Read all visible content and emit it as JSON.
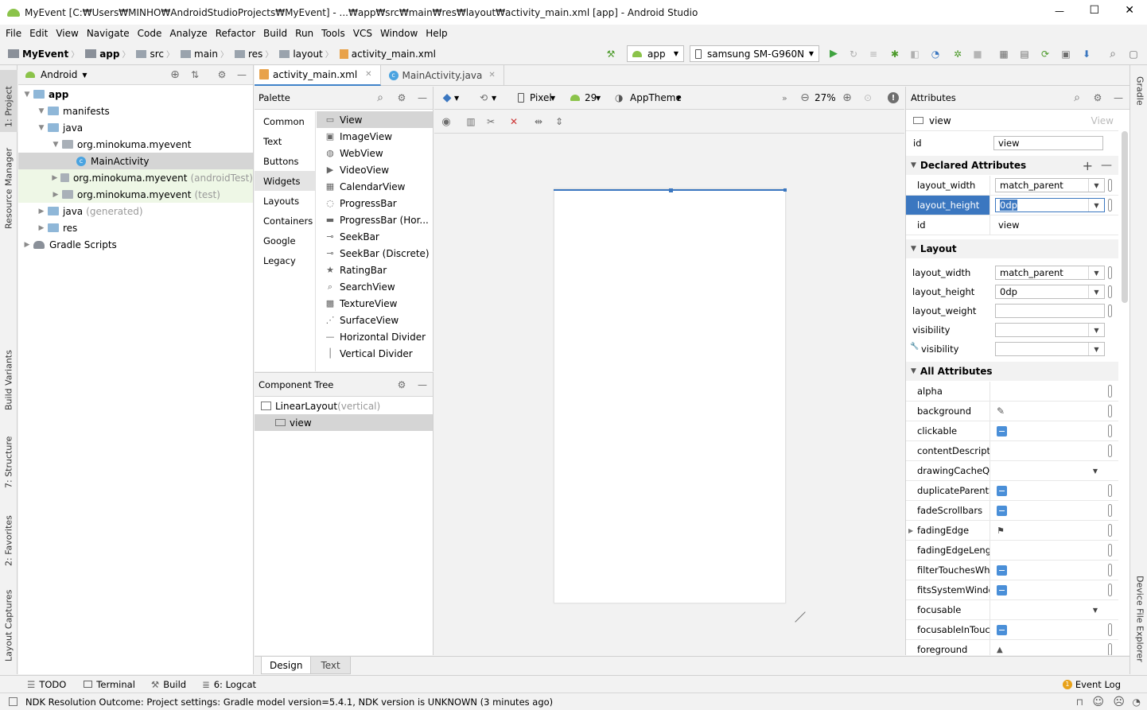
{
  "window": {
    "title": "MyEvent [C:₩Users₩MINHO₩AndroidStudioProjects₩MyEvent] - ...₩app₩src₩main₩res₩layout₩activity_main.xml [app] - Android Studio",
    "minimize": "—",
    "maximize": "☐",
    "close": "✕"
  },
  "menu": [
    "File",
    "Edit",
    "View",
    "Navigate",
    "Code",
    "Analyze",
    "Refactor",
    "Build",
    "Run",
    "Tools",
    "VCS",
    "Window",
    "Help"
  ],
  "breadcrumb": [
    "MyEvent",
    "app",
    "src",
    "main",
    "res",
    "layout",
    "activity_main.xml"
  ],
  "toolbar": {
    "run_config": "app",
    "device": "samsung SM-G960N"
  },
  "left_tabs": [
    "1: Project",
    "Resource Manager",
    "Build Variants",
    "7: Structure",
    "2: Favorites",
    "Layout Captures"
  ],
  "right_tabs": [
    "Gradle",
    "Device File Explorer"
  ],
  "project": {
    "view_mode": "Android",
    "tree": [
      {
        "label": "app",
        "suffix": "",
        "level": 0,
        "kind": "module"
      },
      {
        "label": "manifests",
        "suffix": "",
        "level": 1,
        "kind": "folder"
      },
      {
        "label": "java",
        "suffix": "",
        "level": 1,
        "kind": "folder"
      },
      {
        "label": "org.minokuma.myevent",
        "suffix": "",
        "level": 2,
        "kind": "package"
      },
      {
        "label": "MainActivity",
        "suffix": "",
        "level": 3,
        "kind": "class"
      },
      {
        "label": "org.minokuma.myevent",
        "suffix": "(androidTest)",
        "level": 2,
        "kind": "package"
      },
      {
        "label": "org.minokuma.myevent",
        "suffix": "(test)",
        "level": 2,
        "kind": "package"
      },
      {
        "label": "java",
        "suffix": "(generated)",
        "level": 1,
        "kind": "folder-gen"
      },
      {
        "label": "res",
        "suffix": "",
        "level": 1,
        "kind": "folder"
      },
      {
        "label": "Gradle Scripts",
        "suffix": "",
        "level": 0,
        "kind": "gradle"
      }
    ]
  },
  "editor_tabs": [
    {
      "label": "activity_main.xml",
      "active": true
    },
    {
      "label": "MainActivity.java",
      "active": false
    }
  ],
  "palette": {
    "title": "Palette",
    "categories": [
      "Common",
      "Text",
      "Buttons",
      "Widgets",
      "Layouts",
      "Containers",
      "Google",
      "Legacy"
    ],
    "selected_category": "Widgets",
    "items": [
      "View",
      "ImageView",
      "WebView",
      "VideoView",
      "CalendarView",
      "ProgressBar",
      "ProgressBar (Hor...",
      "SeekBar",
      "SeekBar (Discrete)",
      "RatingBar",
      "SearchView",
      "TextureView",
      "SurfaceView",
      "Horizontal Divider",
      "Vertical Divider"
    ]
  },
  "component_tree": {
    "title": "Component Tree",
    "root": "LinearLayout",
    "root_suffix": "(vertical)",
    "child": "view"
  },
  "design_toolbar": {
    "device": "Pixel",
    "api": "29",
    "theme": "AppTheme",
    "zoom": "27%"
  },
  "bottom_tabs_editor": [
    "Design",
    "Text"
  ],
  "attributes": {
    "title": "Attributes",
    "component_type": "view",
    "component_hint": "View",
    "id_label": "id",
    "id_value": "view",
    "declared_title": "Declared Attributes",
    "declared": [
      {
        "name": "layout_width",
        "value": "match_parent"
      },
      {
        "name": "layout_height",
        "value": "0dp"
      },
      {
        "name": "id",
        "value": "view"
      }
    ],
    "layout_title": "Layout",
    "layout": [
      {
        "name": "layout_width",
        "value": "match_parent"
      },
      {
        "name": "layout_height",
        "value": "0dp"
      },
      {
        "name": "layout_weight",
        "value": ""
      },
      {
        "name": "visibility",
        "value": ""
      },
      {
        "name": "visibility",
        "value": ""
      }
    ],
    "all_title": "All Attributes",
    "all": [
      "alpha",
      "background",
      "clickable",
      "contentDescriptio",
      "drawingCacheQua",
      "duplicateParentSta",
      "fadeScrollbars",
      "fadingEdge",
      "fadingEdgeLength",
      "filterTouchesWhen",
      "fitsSystemWindow",
      "focusable",
      "focusableInTouchM",
      "foreground"
    ]
  },
  "bottom_tools": [
    "TODO",
    "Terminal",
    "Build",
    "6: Logcat"
  ],
  "event_log": "Event Log",
  "event_badge": "1",
  "status": "NDK Resolution Outcome: Project settings: Gradle model version=5.4.1, NDK version is UNKNOWN (3 minutes ago)"
}
